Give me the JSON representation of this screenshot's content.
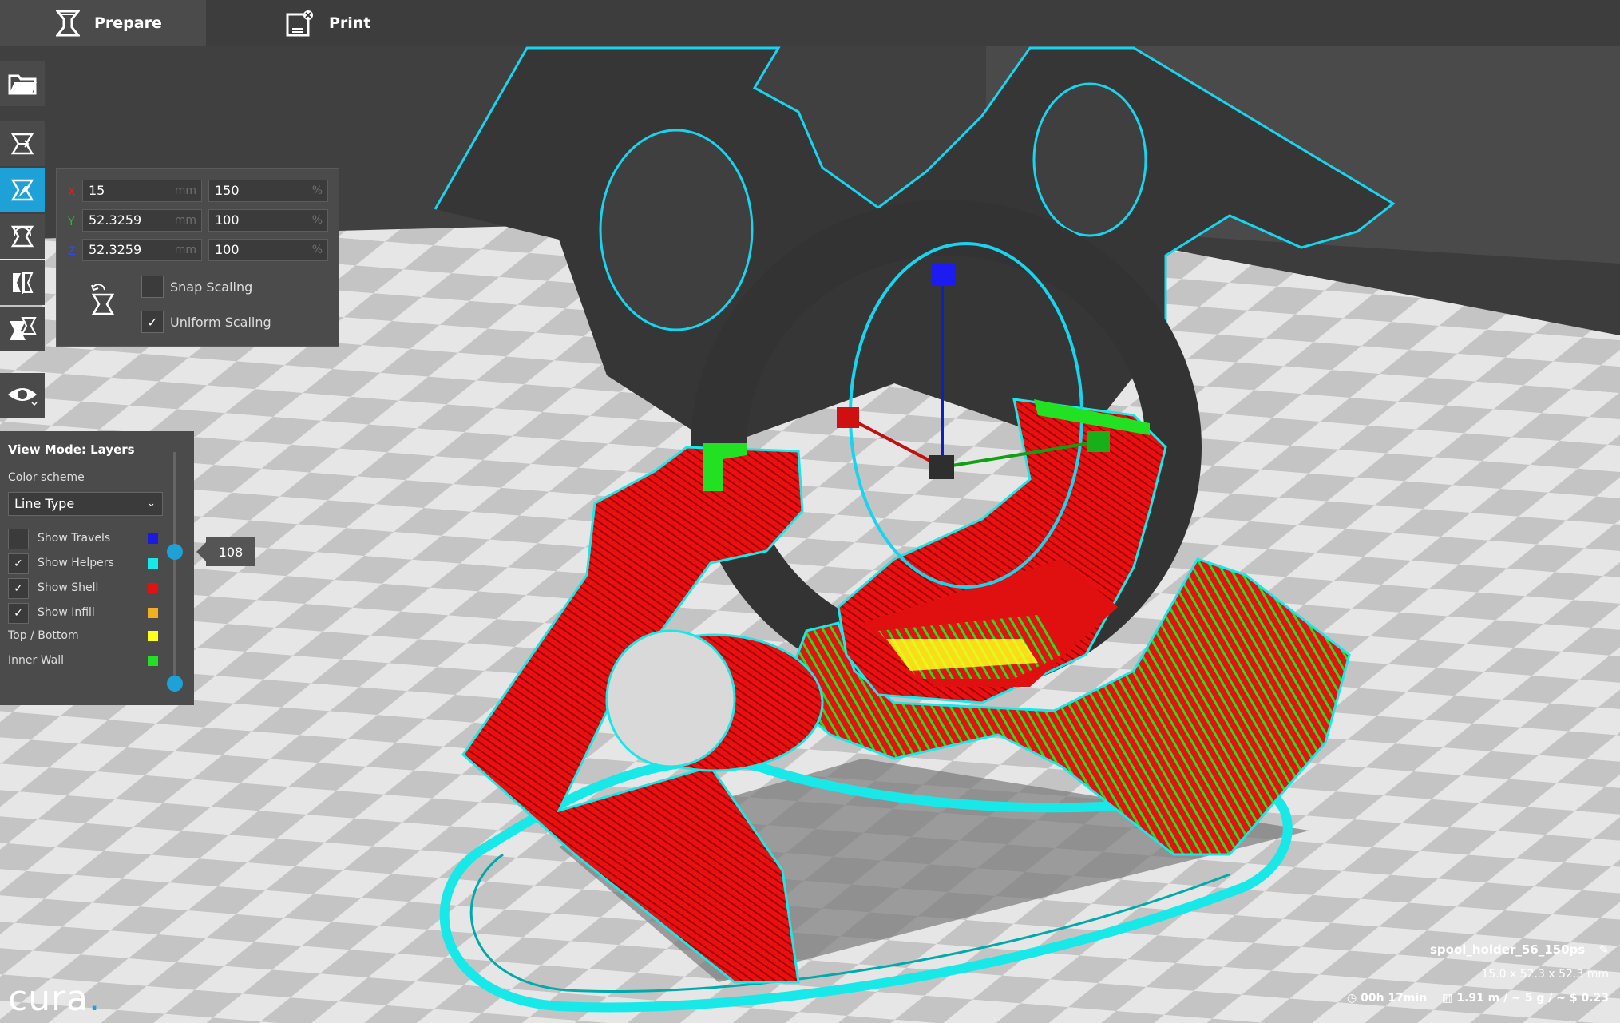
{
  "tabs": [
    {
      "label": "Prepare",
      "icon": "prepare-icon",
      "active": true
    },
    {
      "label": "Print",
      "icon": "print-icon",
      "active": false
    }
  ],
  "toolbar": [
    {
      "name": "open-file-button",
      "icon": "folder-icon"
    },
    {
      "name": "translate-tool-button",
      "icon": "move-icon"
    },
    {
      "name": "scale-tool-button",
      "icon": "scale-icon",
      "active": true
    },
    {
      "name": "rotate-tool-button",
      "icon": "rotate-icon"
    },
    {
      "name": "mirror-tool-button",
      "icon": "mirror-icon"
    },
    {
      "name": "per-model-settings-button",
      "icon": "settings-icon"
    }
  ],
  "scale": {
    "x": {
      "axis": "X",
      "mm": "15",
      "pct": "150",
      "color": "#e02020"
    },
    "y": {
      "axis": "Y",
      "mm": "52.3259",
      "pct": "100",
      "color": "#22c022"
    },
    "z": {
      "axis": "Z",
      "mm": "52.3259",
      "pct": "100",
      "color": "#2a4cff"
    },
    "mm_unit": "mm",
    "pct_unit": "%",
    "snap_label": "Snap Scaling",
    "snap_checked": false,
    "uniform_label": "Uniform Scaling",
    "uniform_checked": true
  },
  "view": {
    "title": "View Mode: Layers",
    "color_scheme_label": "Color scheme",
    "color_scheme_value": "Line Type",
    "rows": [
      {
        "label": "Show Travels",
        "checked": false,
        "color": "#1a1ae0"
      },
      {
        "label": "Show Helpers",
        "checked": true,
        "color": "#19e8e8"
      },
      {
        "label": "Show Shell",
        "checked": true,
        "color": "#e01212"
      },
      {
        "label": "Show Infill",
        "checked": true,
        "color": "#f0b020"
      },
      {
        "label": "Top / Bottom",
        "color": "#ffff1a"
      },
      {
        "label": "Inner Wall",
        "color": "#22e022"
      }
    ],
    "layer": "108",
    "check_mark": "✓"
  },
  "info": {
    "file_name": "spool_holder_56_150ps",
    "dimensions": "15.0 x 52.3 x 52.3 mm",
    "time": "00h 17min",
    "material": "1.91 m / ~ 5 g / ~ $ 0.23"
  },
  "logo": {
    "text": "cura",
    "dot": "."
  },
  "colors": {
    "accent": "#1da1d6",
    "helper": "#19e8e8",
    "shell": "#e01212",
    "infill_top": "#ffff1a",
    "inner_wall": "#22e022"
  }
}
